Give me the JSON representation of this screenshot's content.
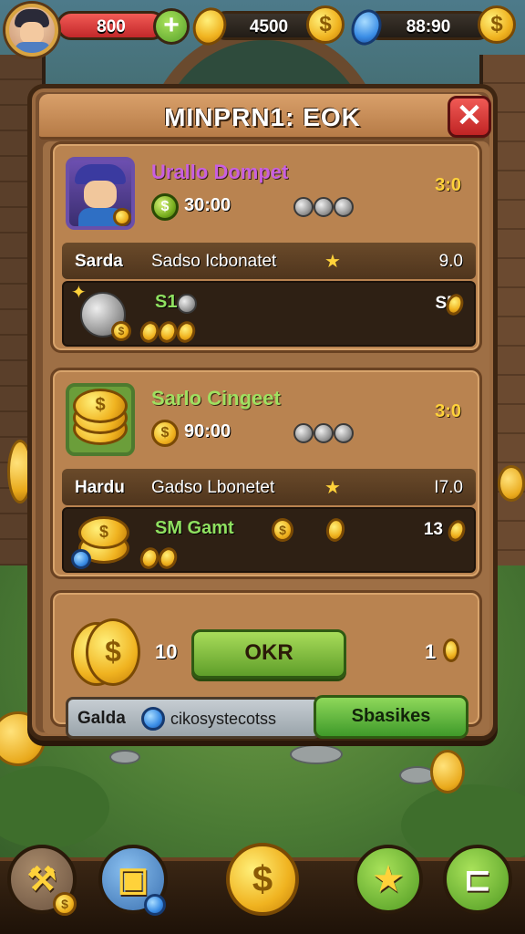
{
  "hud": {
    "coins_red": "800",
    "coins_mid": "4500",
    "gems": "88:90"
  },
  "panel": {
    "title": "MINPRN1: EOK",
    "close_label": "✕"
  },
  "card1": {
    "title": "Urallo Dompet",
    "right_value": "3:0",
    "price": "30:00",
    "strip_left": "Sarda",
    "strip_mid": "Sadso Icbonatet",
    "strip_right": "9.0",
    "sub_label": "S1",
    "sub_right": "S5."
  },
  "card2": {
    "title": "Sarlo Cingeet",
    "right_value": "3:0",
    "price": "90:00",
    "strip_left": "Hardu",
    "strip_mid": "Gadso Lbonetet",
    "strip_right": "I7.0",
    "sub_label": "SM Gamt",
    "sub_right": "13"
  },
  "card3": {
    "num_left": "10",
    "ok_label": "OKR",
    "num_right": "1",
    "search_label": "Galda",
    "search_value": "cikosystecotss",
    "action_label": "Sbasikes"
  },
  "icons": {
    "currency": "coin-icon",
    "premium": "gem-icon",
    "close": "close-icon",
    "star": "star-icon"
  },
  "colors": {
    "panel_wood": "#7a5130",
    "accent_green": "#5f9e2a",
    "close_red": "#c02424",
    "gold": "#ffd23a"
  }
}
